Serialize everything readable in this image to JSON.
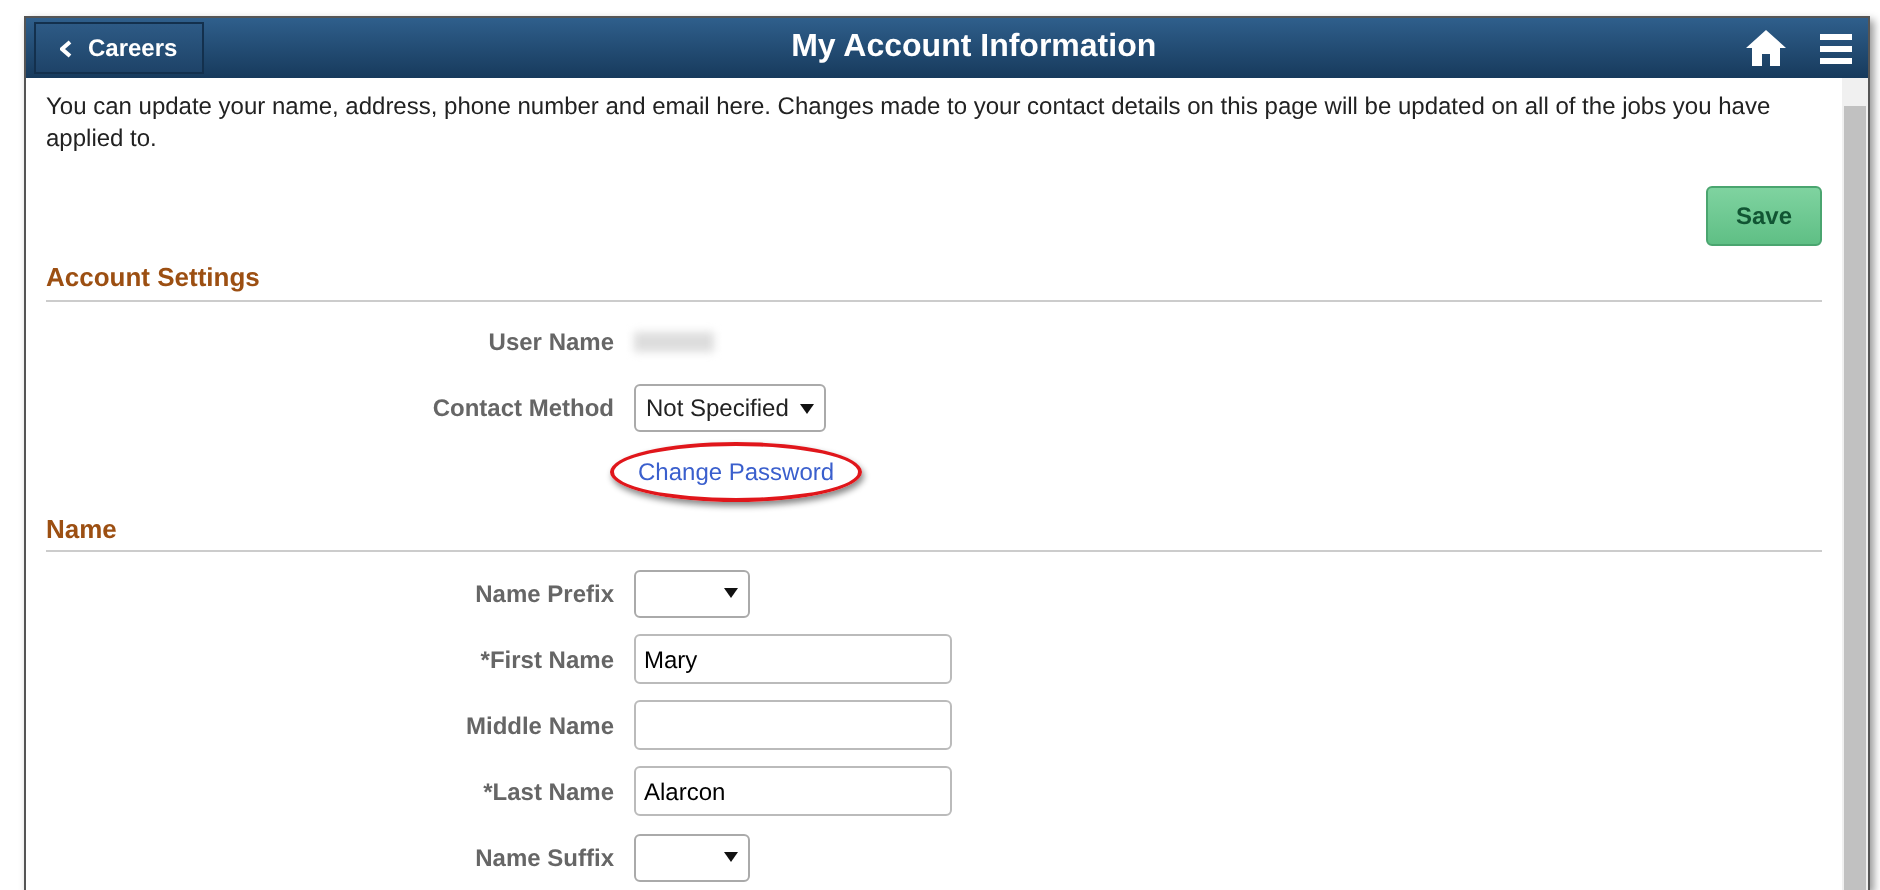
{
  "header": {
    "back_button": "Careers",
    "title": "My Account Information"
  },
  "intro": "You can update your name, address, phone number and email here. Changes made to your contact details on this page will be updated on all of the jobs you have applied to.",
  "save_button": "Save",
  "sections": [
    {
      "title": "Account Settings",
      "fields": [
        {
          "kind": "readonly",
          "label": "User Name",
          "redacted": true
        },
        {
          "kind": "select",
          "label": "Contact Method",
          "value": "Not Specified"
        },
        {
          "kind": "link",
          "text": "Change Password",
          "highlighted": true
        }
      ]
    },
    {
      "title": "Name",
      "fields": [
        {
          "kind": "select",
          "label": "Name Prefix"
        },
        {
          "kind": "input",
          "label": "*First Name",
          "value": "Mary"
        },
        {
          "kind": "input",
          "label": "Middle Name"
        },
        {
          "kind": "input",
          "label": "*Last Name",
          "value": "Alarcon"
        },
        {
          "kind": "select",
          "label": "Name Suffix"
        }
      ]
    }
  ]
}
